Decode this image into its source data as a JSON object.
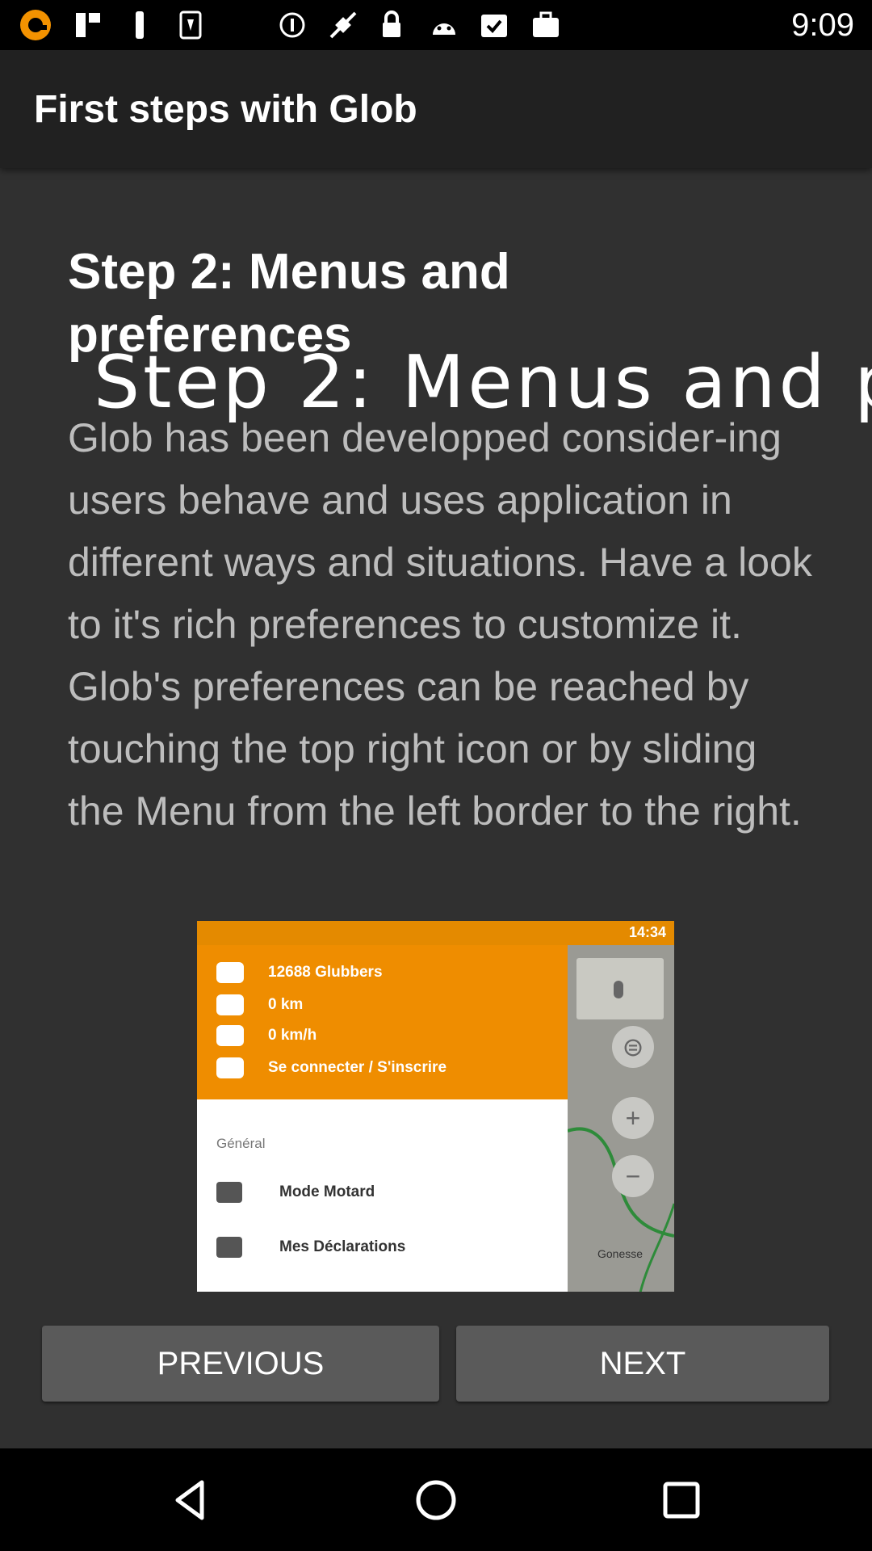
{
  "status_bar": {
    "time": "9:09",
    "icons": [
      "glob-app-icon",
      "flipboard-icon",
      "tool-icon",
      "phone-icon",
      "sync-icon",
      "satellite-icon",
      "lock-icon",
      "android-icon",
      "checklist-icon",
      "briefcase-icon"
    ]
  },
  "app_bar": {
    "title": "First steps with Glob"
  },
  "step": {
    "title": "Step 2: Menus and preferences",
    "overlay_title": "Step 2: Menus and p",
    "description": "Glob has been developped consider-ing users behave and uses application in different ways and situations. Have a look to it's rich preferences to customize it. Glob's preferences can be reached by touching the top right icon or by sliding the Menu from the left border to the right."
  },
  "screenshot": {
    "status_time": "14:34",
    "header_rows": [
      {
        "label": "12688 Glubbers",
        "icon": "glob-icon"
      },
      {
        "label": "0 km",
        "icon": "road-icon"
      },
      {
        "label": "0 km/h",
        "icon": "speedometer-icon"
      },
      {
        "label": "Se connecter / S'inscrire",
        "icon": "person-icon"
      }
    ],
    "section_label": "Général",
    "menu_items": [
      {
        "label": "Mode Motard",
        "icon": "motorbike-icon"
      },
      {
        "label": "Mes Déclarations",
        "icon": "clipboard-check-icon"
      }
    ],
    "map_label": "Gonesse"
  },
  "buttons": {
    "previous": "PREVIOUS",
    "next": "NEXT"
  },
  "colors": {
    "background": "#303030",
    "app_bar": "#212121",
    "button": "#5a5a5a",
    "accent": "#ef8d00"
  }
}
